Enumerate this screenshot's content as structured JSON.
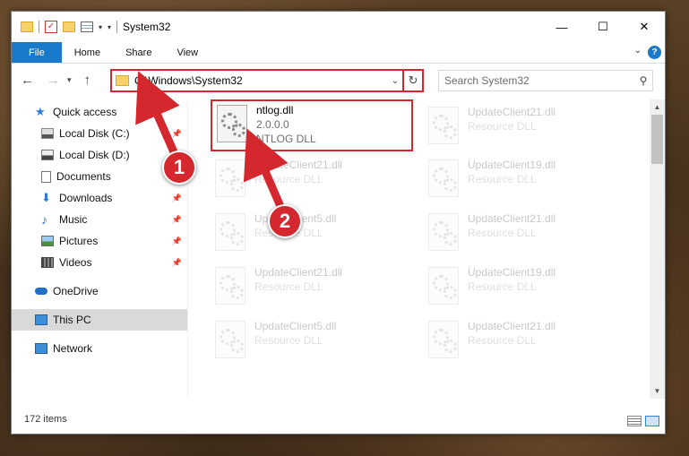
{
  "window": {
    "title": "System32",
    "controls": {
      "minimize": "—",
      "maximize": "☐",
      "close": "✕"
    }
  },
  "ribbon": {
    "tabs": [
      "File",
      "Home",
      "Share",
      "View"
    ],
    "help": "?"
  },
  "address": {
    "path": "C:\\Windows\\System32",
    "search_placeholder": "Search System32"
  },
  "sidebar": {
    "items": [
      {
        "label": "Quick access",
        "icon": "star-icon",
        "pinned": false
      },
      {
        "label": "Local Disk (C:)",
        "icon": "disk-icon",
        "pinned": true
      },
      {
        "label": "Local Disk (D:)",
        "icon": "disk-icon",
        "pinned": false
      },
      {
        "label": "Documents",
        "icon": "documents-icon",
        "pinned": false
      },
      {
        "label": "Downloads",
        "icon": "download-icon",
        "pinned": true
      },
      {
        "label": "Music",
        "icon": "music-icon",
        "pinned": true
      },
      {
        "label": "Pictures",
        "icon": "pictures-icon",
        "pinned": true
      },
      {
        "label": "Videos",
        "icon": "videos-icon",
        "pinned": true
      },
      {
        "label": "OneDrive",
        "icon": "cloud-icon",
        "pinned": false
      },
      {
        "label": "This PC",
        "icon": "pc-icon",
        "pinned": false,
        "selected": true
      },
      {
        "label": "Network",
        "icon": "network-icon",
        "pinned": false
      }
    ]
  },
  "files": [
    {
      "name": "ntlog.dll",
      "line2": "2.0.0.0",
      "line3": "NTLOG DLL",
      "highlight": true
    },
    {
      "name": "UpdateClient21.dll",
      "line2": "Resource DLL"
    },
    {
      "name": "UpdateClient21.dll",
      "line2": "Resource DLL"
    },
    {
      "name": "UpdateClient19.dll",
      "line2": "Resource DLL"
    },
    {
      "name": "UpdateClient5.dll",
      "line2": "Resource DLL"
    },
    {
      "name": "UpdateClient21.dll",
      "line2": "Resource DLL"
    },
    {
      "name": "UpdateClient21.dll",
      "line2": "Resource DLL"
    },
    {
      "name": "UpdateClient19.dll",
      "line2": "Resource DLL"
    },
    {
      "name": "UpdateClient5.dll",
      "line2": "Resource DLL"
    },
    {
      "name": "UpdateClient21.dll",
      "line2": "Resource DLL"
    }
  ],
  "status": {
    "count": "172 items"
  },
  "annotations": {
    "step1": "1",
    "step2": "2"
  },
  "colors": {
    "accent": "#1979ca",
    "annotation": "#d4282e"
  }
}
